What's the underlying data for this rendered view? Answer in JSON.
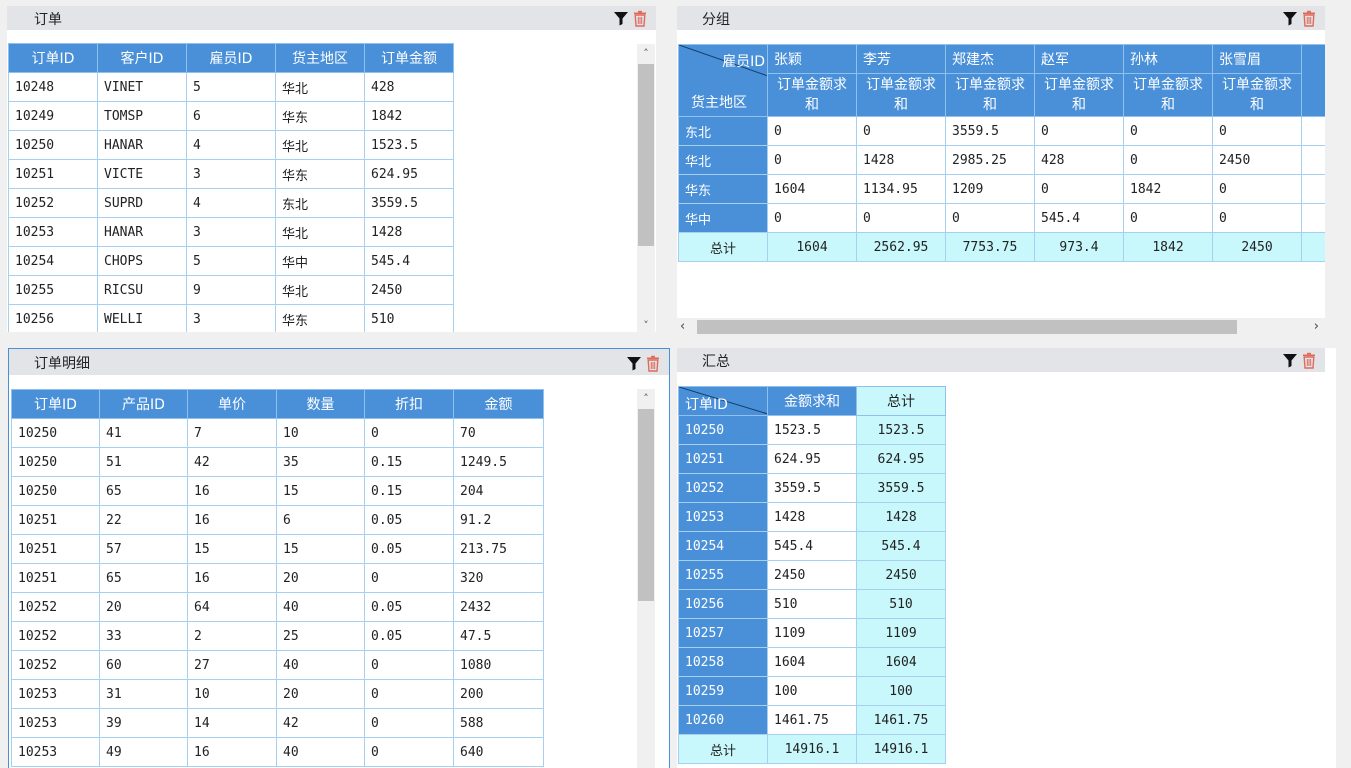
{
  "colors": {
    "header_blue": "#4a90d9",
    "total_cyan": "#c8f8fb",
    "panel_header": "#e2e4e8",
    "delete_red": "#e06a5a"
  },
  "icons": {
    "filter": "filter-icon",
    "delete": "trash-icon"
  },
  "orders": {
    "title": "订单",
    "columns": [
      "订单ID",
      "客户ID",
      "雇员ID",
      "货主地区",
      "订单金额"
    ],
    "rows": [
      [
        "10248",
        "VINET",
        "5",
        "华北",
        "428"
      ],
      [
        "10249",
        "TOMSP",
        "6",
        "华东",
        "1842"
      ],
      [
        "10250",
        "HANAR",
        "4",
        "华北",
        "1523.5"
      ],
      [
        "10251",
        "VICTE",
        "3",
        "华东",
        "624.95"
      ],
      [
        "10252",
        "SUPRD",
        "4",
        "东北",
        "3559.5"
      ],
      [
        "10253",
        "HANAR",
        "3",
        "华北",
        "1428"
      ],
      [
        "10254",
        "CHOPS",
        "5",
        "华中",
        "545.4"
      ],
      [
        "10255",
        "RICSU",
        "9",
        "华北",
        "2450"
      ],
      [
        "10256",
        "WELLI",
        "3",
        "华东",
        "510"
      ]
    ]
  },
  "group": {
    "title": "分组",
    "corner_top": "雇员ID",
    "corner_bottom": "货主地区",
    "employees": [
      "张颖",
      "李芳",
      "郑建杰",
      "赵军",
      "孙林",
      "张雪眉"
    ],
    "measure_label": "订单金额求和",
    "rows": [
      {
        "region": "东北",
        "values": [
          "0",
          "0",
          "3559.5",
          "0",
          "0",
          "0"
        ],
        "cut": "3"
      },
      {
        "region": "华北",
        "values": [
          "0",
          "1428",
          "2985.25",
          "428",
          "0",
          "2450"
        ],
        "cut": "7"
      },
      {
        "region": "华东",
        "values": [
          "1604",
          "1134.95",
          "1209",
          "0",
          "1842",
          "0"
        ],
        "cut": "5"
      },
      {
        "region": "华中",
        "values": [
          "0",
          "0",
          "0",
          "545.4",
          "0",
          "0"
        ],
        "cut": ""
      }
    ],
    "total_label": "总计",
    "totals": [
      "1604",
      "2562.95",
      "7753.75",
      "973.4",
      "1842",
      "2450"
    ],
    "total_cut": "1"
  },
  "details": {
    "title": "订单明细",
    "columns": [
      "订单ID",
      "产品ID",
      "单价",
      "数量",
      "折扣",
      "金额"
    ],
    "rows": [
      [
        "10250",
        "41",
        "7",
        "10",
        "0",
        "70"
      ],
      [
        "10250",
        "51",
        "42",
        "35",
        "0.15",
        "1249.5"
      ],
      [
        "10250",
        "65",
        "16",
        "15",
        "0.15",
        "204"
      ],
      [
        "10251",
        "22",
        "16",
        "6",
        "0.05",
        "91.2"
      ],
      [
        "10251",
        "57",
        "15",
        "15",
        "0.05",
        "213.75"
      ],
      [
        "10251",
        "65",
        "16",
        "20",
        "0",
        "320"
      ],
      [
        "10252",
        "20",
        "64",
        "40",
        "0.05",
        "2432"
      ],
      [
        "10252",
        "33",
        "2",
        "25",
        "0.05",
        "47.5"
      ],
      [
        "10252",
        "60",
        "27",
        "40",
        "0",
        "1080"
      ],
      [
        "10253",
        "31",
        "10",
        "20",
        "0",
        "200"
      ],
      [
        "10253",
        "39",
        "14",
        "42",
        "0",
        "588"
      ],
      [
        "10253",
        "49",
        "16",
        "40",
        "0",
        "640"
      ]
    ]
  },
  "summary": {
    "title": "汇总",
    "corner": "订单ID",
    "columns": [
      "金额求和",
      "总计"
    ],
    "rows": [
      [
        "10250",
        "1523.5",
        "1523.5"
      ],
      [
        "10251",
        "624.95",
        "624.95"
      ],
      [
        "10252",
        "3559.5",
        "3559.5"
      ],
      [
        "10253",
        "1428",
        "1428"
      ],
      [
        "10254",
        "545.4",
        "545.4"
      ],
      [
        "10255",
        "2450",
        "2450"
      ],
      [
        "10256",
        "510",
        "510"
      ],
      [
        "10257",
        "1109",
        "1109"
      ],
      [
        "10258",
        "1604",
        "1604"
      ],
      [
        "10259",
        "100",
        "100"
      ],
      [
        "10260",
        "1461.75",
        "1461.75"
      ]
    ],
    "total_label": "总计",
    "totals": [
      "14916.1",
      "14916.1"
    ]
  }
}
